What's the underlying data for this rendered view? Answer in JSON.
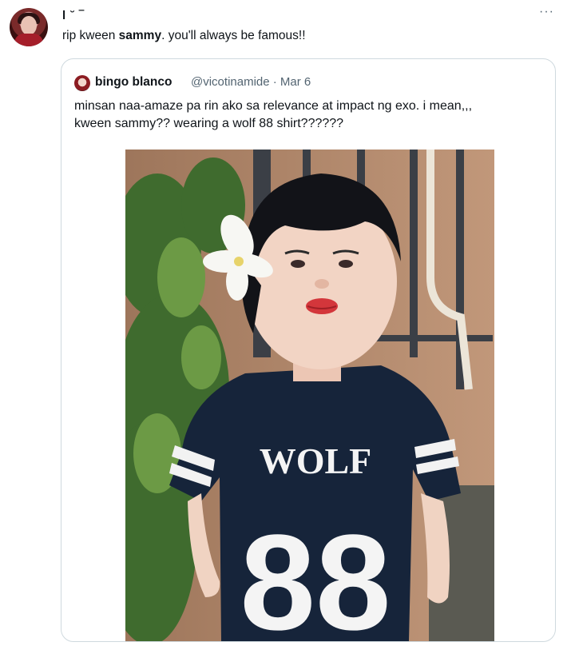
{
  "tweet": {
    "author_redacted": "l ˘ ‾",
    "text_prefix": "rip kween ",
    "text_bold": "sammy",
    "text_suffix": ". you'll always be famous!!",
    "more_icon": "···"
  },
  "quote": {
    "name": "bingo blanco",
    "handle_date": "@vicotinamide · Mar 6",
    "text_line1": "minsan naa-amaze pa rin ako sa relevance at impact ng exo. i mean,,,",
    "text_line2": "kween sammy?? wearing a wolf 88 shirt??????",
    "shirt_text_top": "WOLF",
    "shirt_text_bottom": "88"
  },
  "colors": {
    "text_primary": "#0f1419",
    "text_secondary": "#536471",
    "border": "#cfd9de",
    "shirt": "#16243a",
    "wall": "#b88d6f"
  }
}
